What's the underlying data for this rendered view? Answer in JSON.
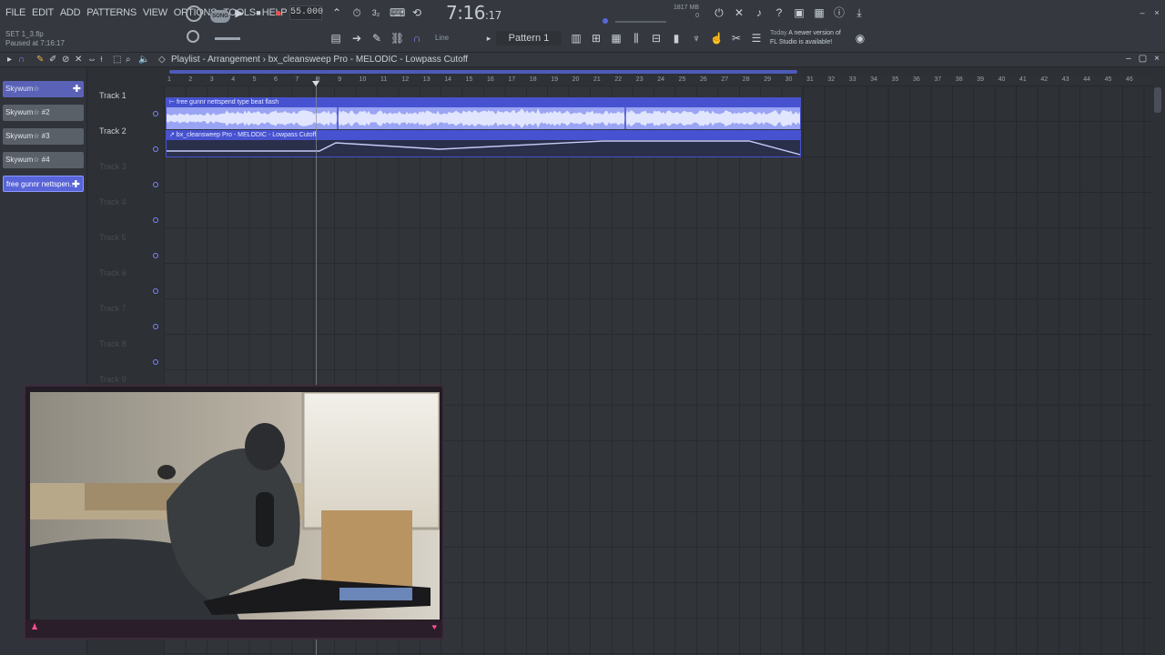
{
  "menu": [
    "FILE",
    "EDIT",
    "ADD",
    "PATTERNS",
    "VIEW",
    "OPTIONS",
    "TOOLS",
    "HELP"
  ],
  "project": {
    "file": "SET 1_3.flp",
    "status": "Paused at 7:16:17"
  },
  "transport": {
    "song_pill": "SONG",
    "tempo": "55.000",
    "time_main": "7:16",
    "time_sub": "17",
    "time_small": "0:17"
  },
  "memory": {
    "mb": "1817 MB",
    "cpu": "0"
  },
  "snap": {
    "mode": "Line"
  },
  "pattern": {
    "label": "Pattern 1"
  },
  "news": {
    "line1": "Today",
    "line1b": "A newer version of",
    "line2": "FL Studio is available!"
  },
  "playlist": {
    "title": "Playlist - Arrangement",
    "crumb1": "bx_cleansweep Pro - MELODIC - Lowpass Cutoff",
    "ruler": [
      "1",
      "2",
      "3",
      "4",
      "5",
      "6",
      "7",
      "8",
      "9",
      "10",
      "11",
      "12",
      "13",
      "14",
      "15",
      "16",
      "17",
      "18",
      "19",
      "20",
      "21",
      "22",
      "23",
      "24",
      "25",
      "26",
      "27",
      "28",
      "29",
      "30",
      "31",
      "32",
      "33",
      "34",
      "35",
      "36",
      "37",
      "38",
      "39",
      "40",
      "41",
      "42",
      "43",
      "44",
      "45",
      "46"
    ]
  },
  "picker": [
    {
      "label": "Skywum☆",
      "style": "first"
    },
    {
      "label": "Skywum☆ #2",
      "style": ""
    },
    {
      "label": "Skywum☆ #3",
      "style": ""
    },
    {
      "label": "Skywum☆ #4",
      "style": ""
    },
    {
      "label": "free gunnr  nettspen..",
      "style": "active"
    }
  ],
  "tracks": [
    "Track 1",
    "Track 2",
    "Track 3",
    "Track 4",
    "Track 5",
    "Track 6",
    "Track 7",
    "Track 8",
    "Track 9"
  ],
  "clips": {
    "audio_name": "⊢ free gunnr  nettspend type beat flash",
    "automation_name": "↗ bx_cleansweep Pro - MELODIC - Lowpass Cutoff"
  },
  "colors": {
    "accent": "#7d86ff",
    "clip": "#8f99ef",
    "clip_header": "#4652d0"
  },
  "icons": [
    "record-icon",
    "play-icon",
    "stop-icon",
    "metronome-icon",
    "settings-icon"
  ]
}
